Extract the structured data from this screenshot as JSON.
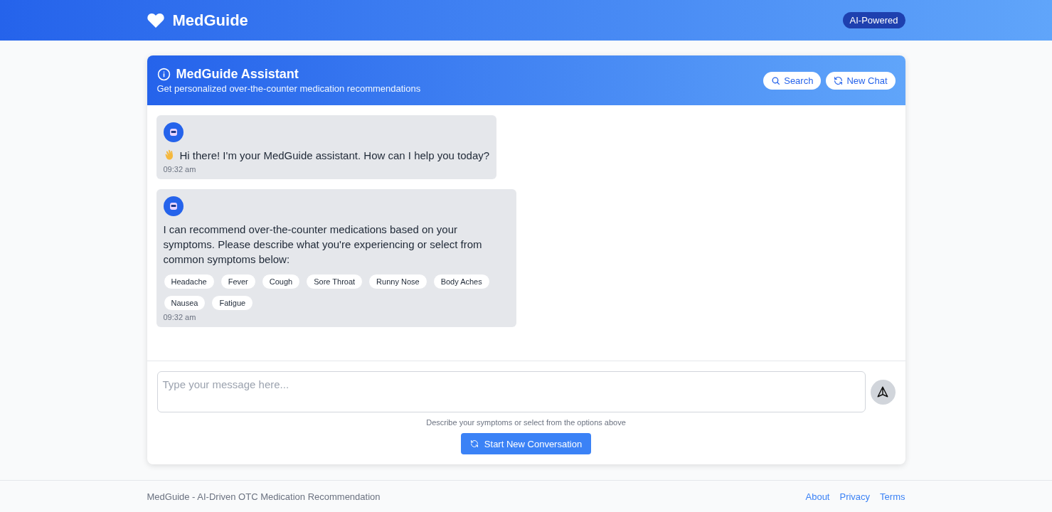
{
  "topbar": {
    "brand": "MedGuide",
    "badge": "AI-Powered"
  },
  "chat_header": {
    "title": "MedGuide Assistant",
    "subtitle": "Get personalized over-the-counter medication recommendations",
    "buttons": [
      {
        "kind": "search",
        "label": "Search"
      },
      {
        "kind": "refresh",
        "label": "New Chat"
      }
    ]
  },
  "messages": [
    {
      "wave": true,
      "text": "Hi there! I'm your MedGuide assistant. How can I help you today?",
      "time": "09:32 am"
    },
    {
      "wave": false,
      "text": "I can recommend over-the-counter medications based on your symptoms. Please describe what you're experiencing or select from common symptoms below:",
      "time": "09:32 am",
      "chips": [
        "Headache",
        "Fever",
        "Cough",
        "Sore Throat",
        "Runny Nose",
        "Body Aches",
        "Nausea",
        "Fatigue"
      ]
    }
  ],
  "composer": {
    "placeholder": "Type your message here...",
    "hint": "Describe your symptoms or select from the options above",
    "start_button": "Start New Conversation"
  },
  "footer": {
    "text": "MedGuide - AI-Driven OTC Medication Recommendation",
    "links": [
      "About",
      "Privacy",
      "Terms"
    ]
  }
}
